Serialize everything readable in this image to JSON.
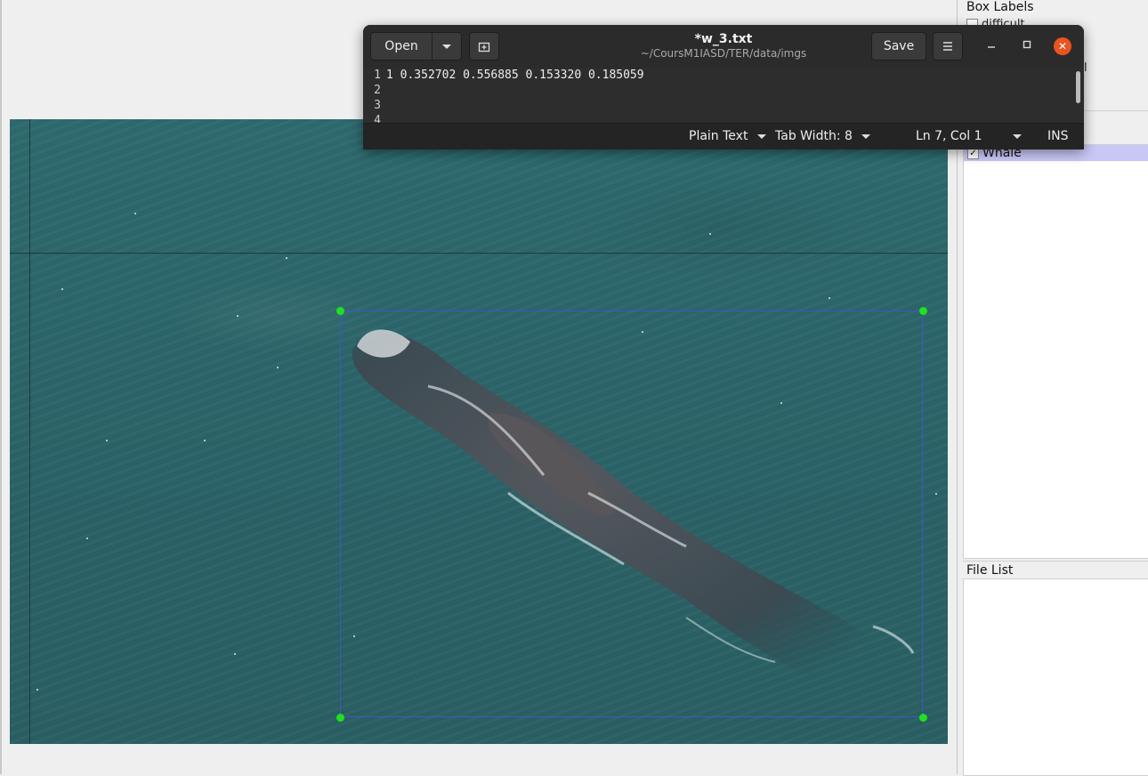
{
  "dock": {
    "box_labels_title": "Box Labels",
    "difficult_label": "difficult",
    "use_default_label_tail": "el",
    "label_items": [
      {
        "label": "Whale",
        "checked": true,
        "check_mark": "✓"
      }
    ],
    "file_list_title": "File List"
  },
  "gedit": {
    "open_label": "Open",
    "save_label": "Save",
    "title": "*w_3.txt",
    "path": "~/CoursM1IASD/TER/data/imgs",
    "lines": [
      {
        "num": "1",
        "text": "1 0.352702 0.556885 0.153320 0.185059"
      },
      {
        "num": "2",
        "text": ""
      },
      {
        "num": "3",
        "text": ""
      },
      {
        "num": "4",
        "text": ""
      }
    ],
    "status": {
      "language": "Plain Text",
      "tab_width": "Tab Width: 8",
      "position": "Ln 7, Col 1",
      "mode": "INS"
    },
    "icons": {
      "open_dropdown": "chevron-down-icon",
      "new_tab": "new-tab-icon",
      "menu": "hamburger-menu-icon",
      "minimize": "minimize-icon",
      "maximize": "maximize-icon",
      "close": "close-icon"
    }
  },
  "canvas": {
    "box_label": "Whale",
    "box_color": "#3f56c7",
    "handle_color": "#1de21d"
  }
}
